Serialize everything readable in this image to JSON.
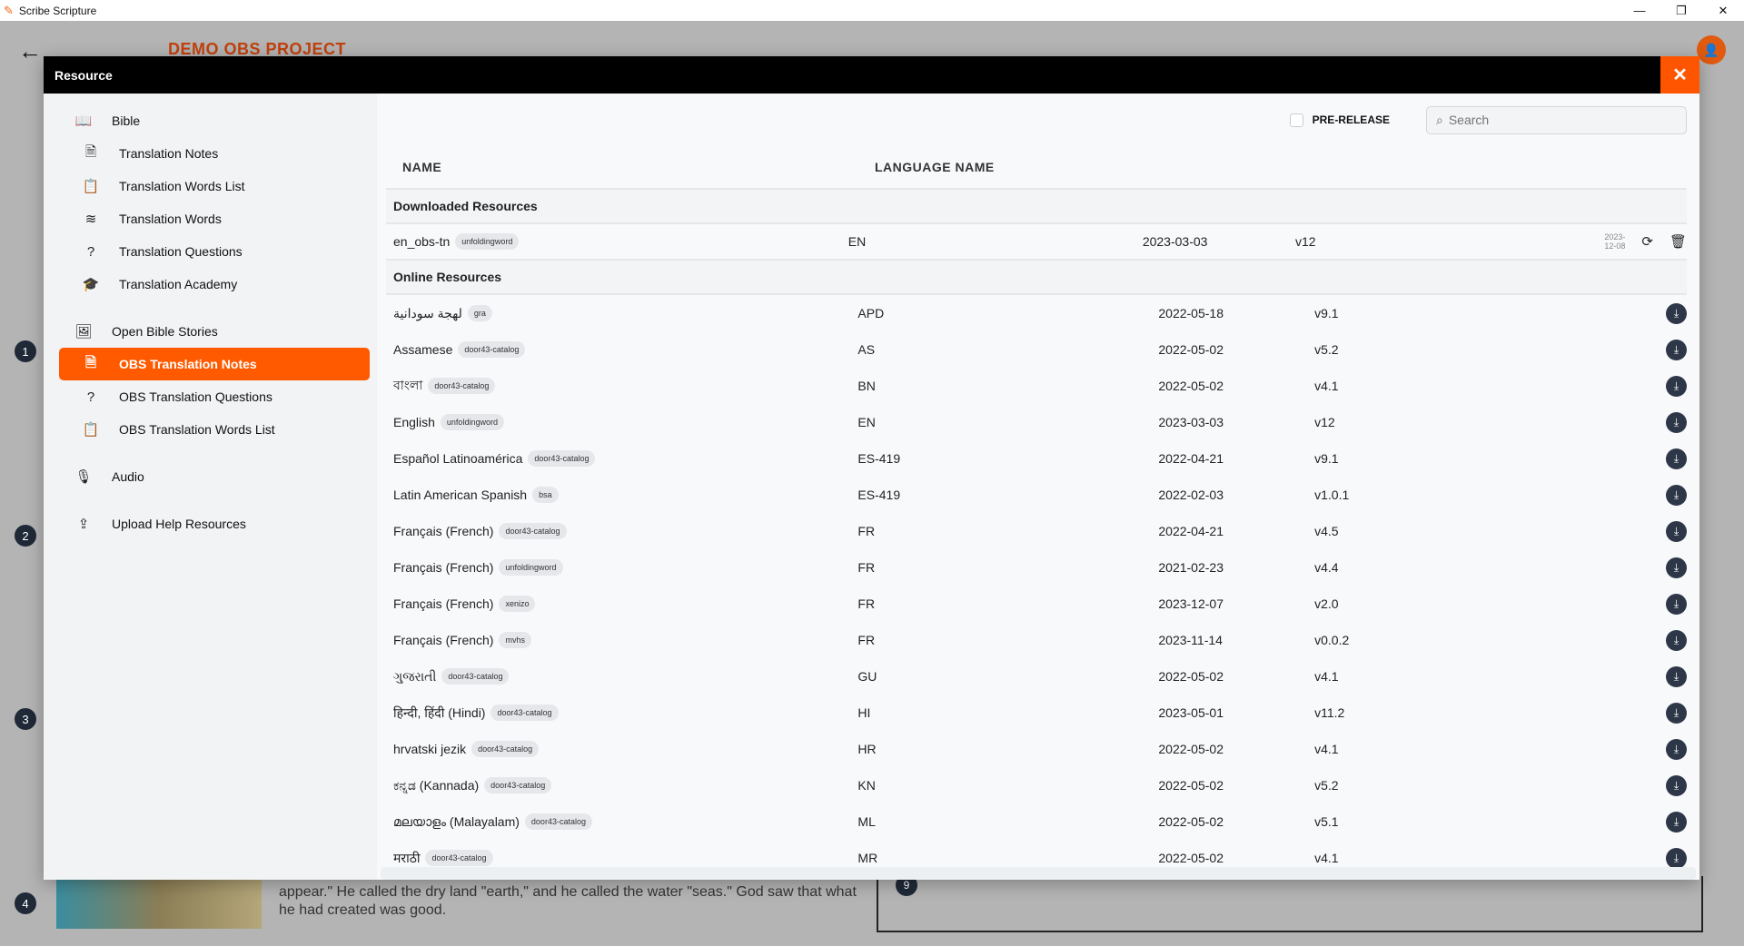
{
  "window": {
    "title": "Scribe Scripture",
    "minimize": "—",
    "maximize": "❐",
    "close": "✕"
  },
  "background": {
    "project_title": "DEMO OBS PROJECT",
    "numbers": [
      "1",
      "2",
      "3",
      "4"
    ],
    "story_text": "appear.\" He called the dry land \"earth,\" and he called the water \"seas.\" God saw that what he had created was good.",
    "panel_number": "9"
  },
  "modal": {
    "title": "Resource",
    "close_icon": "✕"
  },
  "sidebar": {
    "items": [
      {
        "label": "Bible",
        "icon": "book-icon",
        "glyph": "📖",
        "level": "top"
      },
      {
        "label": "Translation Notes",
        "icon": "document-icon",
        "glyph": "🗎",
        "level": "sub"
      },
      {
        "label": "Translation Words List",
        "icon": "clipboard-list-icon",
        "glyph": "📋",
        "level": "sub"
      },
      {
        "label": "Translation Words",
        "icon": "layers-icon",
        "glyph": "≋",
        "level": "sub"
      },
      {
        "label": "Translation Questions",
        "icon": "question-circle-icon",
        "glyph": "?",
        "level": "sub"
      },
      {
        "label": "Translation Academy",
        "icon": "graduation-cap-icon",
        "glyph": "🎓",
        "level": "sub",
        "gap_after": true
      },
      {
        "label": "Open Bible Stories",
        "icon": "image-icon",
        "glyph": "🖼",
        "level": "top"
      },
      {
        "label": "OBS Translation Notes",
        "icon": "document-icon",
        "glyph": "🗎",
        "level": "sub",
        "active": true
      },
      {
        "label": "OBS Translation Questions",
        "icon": "question-circle-icon",
        "glyph": "?",
        "level": "sub"
      },
      {
        "label": "OBS Translation Words List",
        "icon": "clipboard-list-icon",
        "glyph": "📋",
        "level": "sub",
        "gap_after": true
      },
      {
        "label": "Audio",
        "icon": "microphone-icon",
        "glyph": "🎙",
        "level": "top",
        "gap_after": true
      },
      {
        "label": "Upload Help Resources",
        "icon": "upload-icon",
        "glyph": "⇪",
        "level": "top"
      }
    ]
  },
  "toolbar": {
    "prerelease_label": "PRE-RELEASE",
    "prerelease_checked": false,
    "search_placeholder": "Search",
    "search_value": ""
  },
  "table": {
    "headers": {
      "name": "NAME",
      "language": "LANGUAGE NAME"
    },
    "downloaded_title": "Downloaded Resources",
    "downloaded": [
      {
        "name": "en_obs-tn",
        "tag": "unfoldingword",
        "lang": "EN",
        "date": "2023-03-03",
        "version": "v12",
        "downloaded_date": "2023-12-08"
      }
    ],
    "online_title": "Online Resources",
    "online": [
      {
        "name": "لهجة سودانية",
        "tag": "gra",
        "lang": "APD",
        "date": "2022-05-18",
        "version": "v9.1"
      },
      {
        "name": "Assamese",
        "tag": "door43-catalog",
        "lang": "AS",
        "date": "2022-05-02",
        "version": "v5.2"
      },
      {
        "name": "বাংলা",
        "tag": "door43-catalog",
        "lang": "BN",
        "date": "2022-05-02",
        "version": "v4.1"
      },
      {
        "name": "English",
        "tag": "unfoldingword",
        "lang": "EN",
        "date": "2023-03-03",
        "version": "v12"
      },
      {
        "name": "Español Latinoamérica",
        "tag": "door43-catalog",
        "lang": "ES-419",
        "date": "2022-04-21",
        "version": "v9.1"
      },
      {
        "name": "Latin American Spanish",
        "tag": "bsa",
        "lang": "ES-419",
        "date": "2022-02-03",
        "version": "v1.0.1"
      },
      {
        "name": "Français (French)",
        "tag": "door43-catalog",
        "lang": "FR",
        "date": "2022-04-21",
        "version": "v4.5"
      },
      {
        "name": "Français (French)",
        "tag": "unfoldingword",
        "lang": "FR",
        "date": "2021-02-23",
        "version": "v4.4"
      },
      {
        "name": "Français (French)",
        "tag": "xenizo",
        "lang": "FR",
        "date": "2023-12-07",
        "version": "v2.0"
      },
      {
        "name": "Français (French)",
        "tag": "mvhs",
        "lang": "FR",
        "date": "2023-11-14",
        "version": "v0.0.2"
      },
      {
        "name": "ગુજરાતી",
        "tag": "door43-catalog",
        "lang": "GU",
        "date": "2022-05-02",
        "version": "v4.1"
      },
      {
        "name": "हिन्दी, हिंदी (Hindi)",
        "tag": "door43-catalog",
        "lang": "HI",
        "date": "2023-05-01",
        "version": "v11.2"
      },
      {
        "name": "hrvatski jezik",
        "tag": "door43-catalog",
        "lang": "HR",
        "date": "2022-05-02",
        "version": "v4.1"
      },
      {
        "name": "ಕನ್ನಡ (Kannada)",
        "tag": "door43-catalog",
        "lang": "KN",
        "date": "2022-05-02",
        "version": "v5.2"
      },
      {
        "name": "മലയാളം (Malayalam)",
        "tag": "door43-catalog",
        "lang": "ML",
        "date": "2022-05-02",
        "version": "v5.1"
      },
      {
        "name": "मराठी",
        "tag": "door43-catalog",
        "lang": "MR",
        "date": "2022-05-02",
        "version": "v4.1"
      }
    ]
  },
  "colors": {
    "accent": "#ff5a00",
    "header": "#000000",
    "download_button": "#2d3748"
  }
}
